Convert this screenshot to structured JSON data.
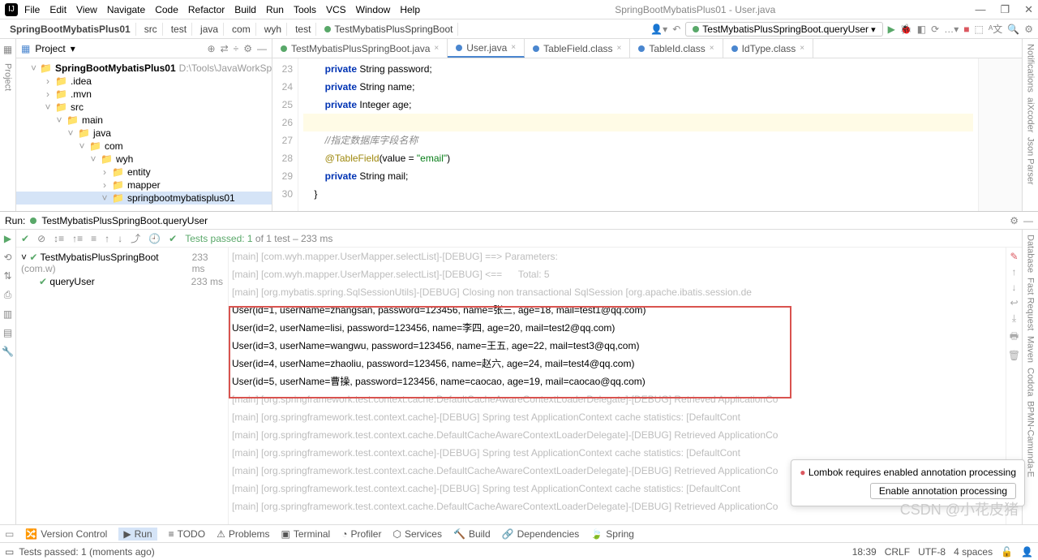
{
  "app": {
    "title": "SpringBootMybatisPlus01 - User.java"
  },
  "menu": [
    "File",
    "Edit",
    "View",
    "Navigate",
    "Code",
    "Refactor",
    "Build",
    "Run",
    "Tools",
    "VCS",
    "Window",
    "Help"
  ],
  "breadcrumbs": [
    "SpringBootMybatisPlus01",
    "src",
    "test",
    "java",
    "com",
    "wyh",
    "test",
    "TestMybatisPlusSpringBoot"
  ],
  "runconfig": {
    "name": "TestMybatisPlusSpringBoot.queryUser"
  },
  "project": {
    "label": "Project",
    "root": {
      "name": "SpringBootMybatisPlus01",
      "path": "D:\\Tools\\JavaWorkSpace\\Sprin"
    },
    "nodes": [
      ".idea",
      ".mvn",
      "src",
      "main",
      "java",
      "com",
      "wyh",
      "entity",
      "mapper",
      "springbootmybatisplus01"
    ]
  },
  "editorTabs": [
    {
      "label": "TestMybatisPlusSpringBoot.java"
    },
    {
      "label": "User.java",
      "active": true
    },
    {
      "label": "TableField.class"
    },
    {
      "label": "TableId.class"
    },
    {
      "label": "IdType.class"
    }
  ],
  "code": {
    "startLine": 23,
    "lines": [
      "        private String password;",
      "        private String name;",
      "        private Integer age;",
      "",
      "        //指定数据库字段名称",
      "        @TableField(value = \"email\")",
      "        private String mail;",
      "    }"
    ]
  },
  "run": {
    "title": "TestMybatisPlusSpringBoot.queryUser",
    "label": "Run:",
    "testsPassed": "Tests passed: 1",
    "testsTotal": " of 1 test – 233 ms",
    "tree": [
      {
        "name": "TestMybatisPlusSpringBoot",
        "hint": "(com.w)",
        "ms": "233 ms"
      },
      {
        "name": "queryUser",
        "ms": "233 ms"
      }
    ]
  },
  "console": {
    "faded": [
      "[main] [com.wyh.mapper.UserMapper.selectList]-[DEBUG] ==> Parameters:",
      "[main] [com.wyh.mapper.UserMapper.selectList]-[DEBUG] <==      Total: 5",
      "[main] [org.mybatis.spring.SqlSessionUtils]-[DEBUG] Closing non transactional SqlSession [org.apache.ibatis.session.de"
    ],
    "results": [
      "User(id=1, userName=zhangsan, password=123456, name=张三, age=18, mail=test1@qq.com)",
      "User(id=2, userName=lisi, password=123456, name=李四, age=20, mail=test2@qq.com)",
      "User(id=3, userName=wangwu, password=123456, name=王五, age=22, mail=test3@qq,com)",
      "User(id=4, userName=zhaoliu, password=123456, name=赵六, age=24, mail=test4@qq.com)",
      "User(id=5, userName=曹操, password=123456, name=caocao, age=19, mail=caocao@qq.com)"
    ],
    "tail": [
      "[main] [org.springframework.test.context.cache.DefaultCacheAwareContextLoaderDelegate]-[DEBUG] Retrieved ApplicationCo",
      "[main] [org.springframework.test.context.cache]-[DEBUG] Spring test ApplicationContext cache statistics: [DefaultCont",
      "[main] [org.springframework.test.context.cache.DefaultCacheAwareContextLoaderDelegate]-[DEBUG] Retrieved ApplicationCo",
      "[main] [org.springframework.test.context.cache]-[DEBUG] Spring test ApplicationContext cache statistics: [DefaultCont",
      "[main] [org.springframework.test.context.cache.DefaultCacheAwareContextLoaderDelegate]-[DEBUG] Retrieved ApplicationCo",
      "[main] [org.springframework.test.context.cache]-[DEBUG] Spring test ApplicationContext cache statistics: [DefaultCont",
      "[main] [org.springframework.test.context.cache.DefaultCacheAwareContextLoaderDelegate]-[DEBUG] Retrieved ApplicationCo"
    ]
  },
  "popup": {
    "msg": "Lombok requires enabled annotation processing",
    "btn": "Enable annotation processing"
  },
  "bottomBar": [
    "Version Control",
    "Run",
    "TODO",
    "Problems",
    "Terminal",
    "Profiler",
    "Services",
    "Build",
    "Dependencies",
    "Spring"
  ],
  "status": {
    "msg": "Tests passed: 1 (moments ago)",
    "time": "18:39",
    "enc": "CRLF",
    "cs": "UTF-8",
    "sp": "4 spaces"
  },
  "rightTools": [
    "Notifications",
    "aiXcoder",
    "Json Parser",
    "Database",
    "Fast Request",
    "Maven",
    "Codota",
    "BPMN-Camunda-E"
  ],
  "watermark": "CSDN @小花皮猪"
}
